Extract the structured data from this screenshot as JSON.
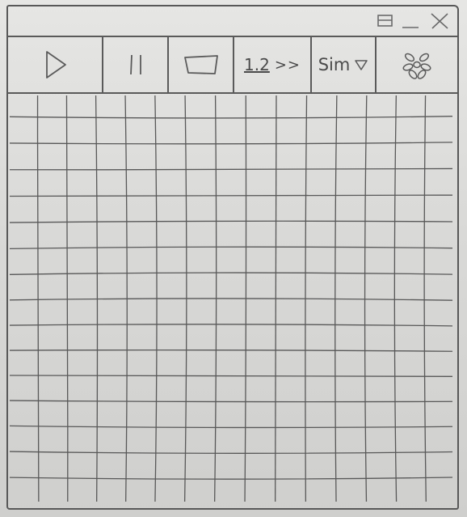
{
  "window": {
    "controls": {
      "restore_icon": "restore-icon",
      "minimize_icon": "minimize-icon",
      "close_icon": "close-icon"
    }
  },
  "toolbar": {
    "play_icon": "play-icon",
    "pause_icon": "pause-icon",
    "stop_icon": "stop-icon",
    "speed_value": "1.2",
    "speed_arrows": ">>",
    "sim_label": "Sim",
    "sim_dropdown_icon": "triangle-down-icon",
    "flower_icon": "flower-icon"
  },
  "grid": {
    "columns": 15,
    "rows": 16
  },
  "colors": {
    "ink": "#585858",
    "paper": "#dcdcda"
  }
}
